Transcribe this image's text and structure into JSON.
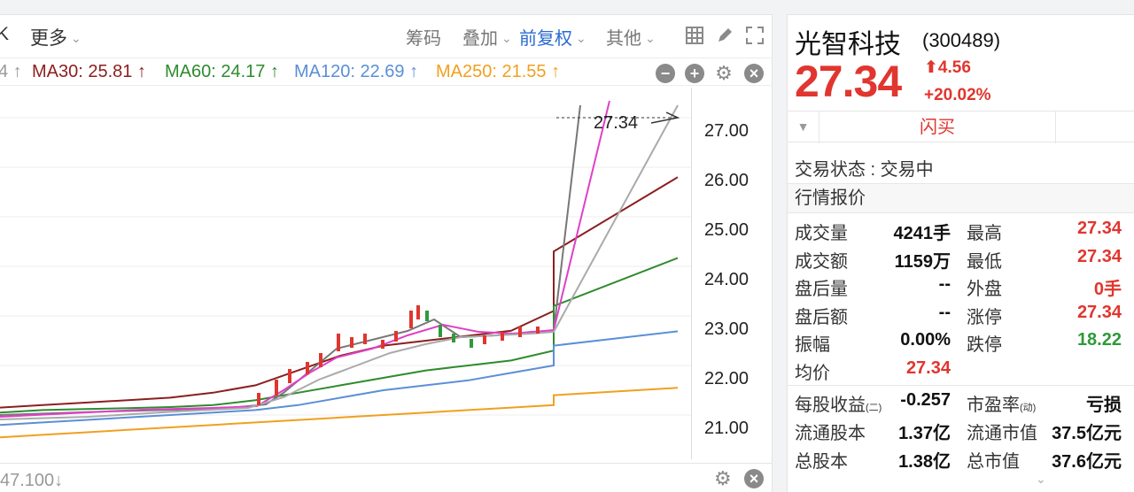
{
  "toolbar": {
    "partial_left": "K",
    "more": "更多",
    "chips": "筹码",
    "overlay": "叠加",
    "adjust": "前复权",
    "other": "其他"
  },
  "ma": {
    "partial": "4 ↑",
    "ma30": "MA30: 25.81 ↑",
    "ma60": "MA60: 24.17 ↑",
    "ma120": "MA120: 22.69 ↑",
    "ma250": "MA250: 21.55 ↑"
  },
  "colors": {
    "ma30": "#8b1f1f",
    "ma60": "#2e8b2e",
    "ma120": "#5b8fd6",
    "ma250": "#f0a020",
    "up": "#e0362f",
    "down": "#2e9a3a"
  },
  "chart_data": {
    "type": "line",
    "yaxis_ticks": [
      "27.00",
      "26.00",
      "25.00",
      "24.00",
      "23.00",
      "22.00",
      "21.00"
    ],
    "ylim": [
      20.5,
      27.5
    ],
    "price_marker": "27.34",
    "volume_label": "47.100↓",
    "series": [
      {
        "name": "MA30",
        "values": [
          21.15,
          21.2,
          21.25,
          21.3,
          21.35,
          21.45,
          21.6,
          21.9,
          22.2,
          22.4,
          22.5,
          22.6,
          22.7,
          23.1,
          24.3,
          25.8
        ]
      },
      {
        "name": "MA60",
        "values": [
          21.05,
          21.1,
          21.12,
          21.14,
          21.16,
          21.2,
          21.3,
          21.45,
          21.6,
          21.75,
          21.9,
          22.0,
          22.1,
          22.3,
          23.2,
          24.17
        ]
      },
      {
        "name": "MA120",
        "values": [
          20.8,
          20.85,
          20.9,
          20.95,
          21.0,
          21.05,
          21.1,
          21.2,
          21.35,
          21.5,
          21.6,
          21.7,
          21.85,
          22.0,
          22.4,
          22.69
        ]
      },
      {
        "name": "MA250",
        "values": [
          20.55,
          20.6,
          20.65,
          20.7,
          20.75,
          20.8,
          20.85,
          20.9,
          20.95,
          21.0,
          21.05,
          21.1,
          21.15,
          21.2,
          21.4,
          21.55
        ]
      }
    ]
  },
  "quote": {
    "name": "光智科技",
    "code": "(300489)",
    "price": "27.34",
    "change": "4.56",
    "change_pct": "+20.02%",
    "flash_buy": "闪买",
    "trade_status": "交易状态 : 交易中",
    "section_title": "行情报价",
    "rows": [
      {
        "l1": "成交量",
        "v1": "4241手",
        "l2": "最高",
        "v2": "27.34"
      },
      {
        "l1": "成交额",
        "v1": "1159万",
        "l2": "最低",
        "v2": "27.34"
      },
      {
        "l1": "盘后量",
        "v1": "--",
        "l2": "外盘",
        "v2": "0手"
      },
      {
        "l1": "盘后额",
        "v1": "--",
        "l2": "涨停",
        "v2": "27.34"
      },
      {
        "l1": "振幅",
        "v1": "0.00%",
        "l2": "跌停",
        "v2": "18.22"
      },
      {
        "l1": "均价",
        "v1": "27.34",
        "l2": "",
        "v2": ""
      }
    ],
    "rows2": [
      {
        "l1": "每股收益",
        "l1sub": "(二)",
        "v1": "-0.257",
        "l2": "市盈率",
        "l2sub": "(动)",
        "v2": "亏损"
      },
      {
        "l1": "流通股本",
        "v1": "1.37亿",
        "l2": "流通市值",
        "v2": "37.5亿元"
      },
      {
        "l1": "总股本",
        "v1": "1.38亿",
        "l2": "总市值",
        "v2": "37.6亿元"
      }
    ]
  }
}
